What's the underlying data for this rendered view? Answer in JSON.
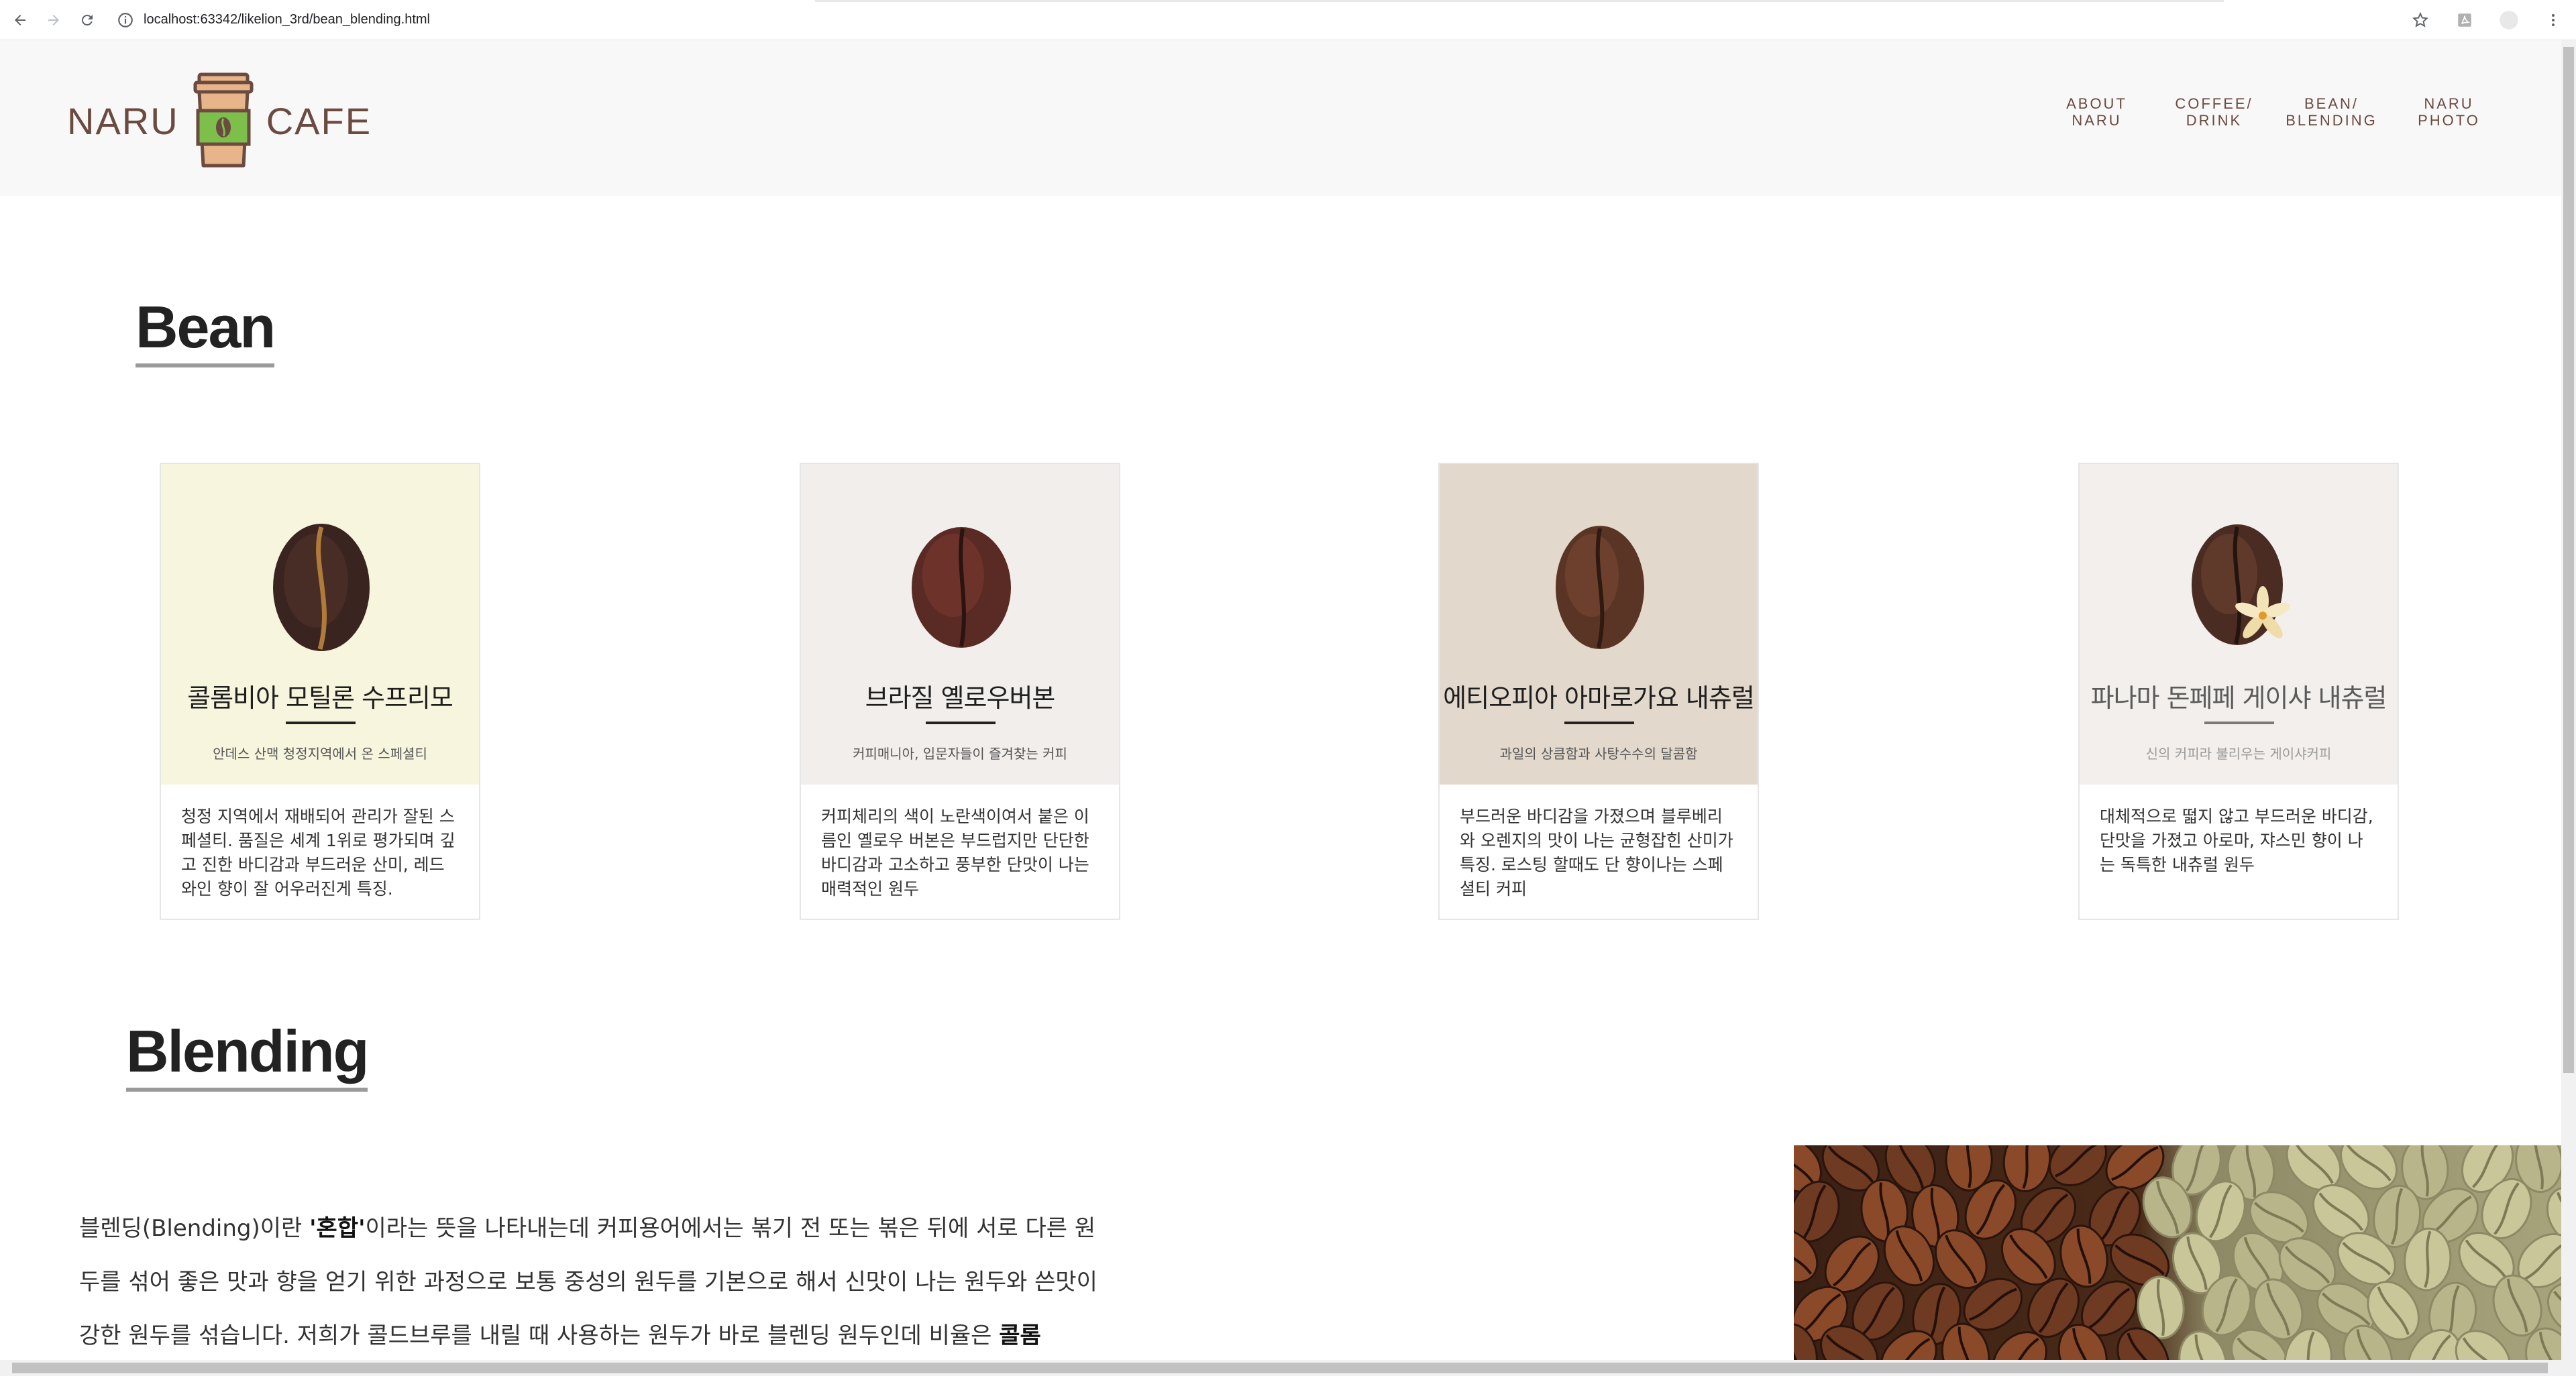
{
  "browser": {
    "url": "localhost:63342/likelion_3rd/bean_blending.html"
  },
  "header": {
    "logo_left": "NARU",
    "logo_right": "CAFE",
    "nav": [
      {
        "line1": "ABOUT",
        "line2": "NARU"
      },
      {
        "line1": "COFFEE/",
        "line2": "DRINK"
      },
      {
        "line1": "BEAN/",
        "line2": "BLENDING"
      },
      {
        "line1": "NARU",
        "line2": "PHOTO"
      }
    ]
  },
  "bean_section": {
    "title": "Bean",
    "cards": [
      {
        "name": "콜롬비아 모틸론 수프리모",
        "sub": "안데스 산맥 청정지역에서 온 스페셜티",
        "desc": "청정 지역에서 재배되어 관리가 잘된 스페셜티. 품질은 세계 1위로 평가되며 깊고 진한 바디감과 부드러운 산미, 레드와인 향이 잘 어우러진게 특징.",
        "bg": "#f7f5dd"
      },
      {
        "name": "브라질 옐로우버본",
        "sub": "커피매니아, 입문자들이 즐겨찾는 커피",
        "desc": "커피체리의 색이 노란색이여서 붙은 이름인 옐로우 버본은 부드럽지만 단단한 바디감과 고소하고 풍부한 단맛이 나는 매력적인 원두",
        "bg": "#f2eeec"
      },
      {
        "name": "에티오피아 아마로가요 내츄럴",
        "sub": "과일의 상큼함과 사탕수수의 달콤함",
        "desc": "부드러운 바디감을 가졌으며 블루베리와 오렌지의 맛이 나는 균형잡힌 산미가 특징. 로스팅 할때도 단 향이나는 스페셜티 커피",
        "bg": "#e2d9cc"
      },
      {
        "name": "파나마 돈페페 게이샤 내츄럴",
        "sub": "신의 커피라 불리우는 게이샤커피",
        "desc": "대체적으로 떫지 않고 부드러운 바디감, 단맛을 가졌고 아로마, 쟈스민 향이 나는 독특한 내츄럴 원두",
        "bg": "#f2efec"
      }
    ]
  },
  "blend_section": {
    "title": "Blending",
    "p_part1": "블렌딩(Blending)이란 ",
    "p_bold1": "'혼합'",
    "p_part2": "이라는 뜻을 나타내는데 커피용어에서는 볶기 전 또는 볶은 뒤에 서로 다른 원두를 섞어 좋은 맛과 향을 얻기 위한 과정으로 보통 중성의 원두를 기본으로 해서 신맛이 나는 원두와 쓴맛이 강한 원두를 섞습니다. 저희가 콜드브루를 내릴 때 사용하는 원두가 바로 블렌딩 원두인데 비율은 ",
    "p_bold2": "콜롬"
  },
  "colors": {
    "brand_brown": "#6b4a3f",
    "cup_green": "#7cbf4b",
    "cup_tan": "#e8b48a"
  }
}
